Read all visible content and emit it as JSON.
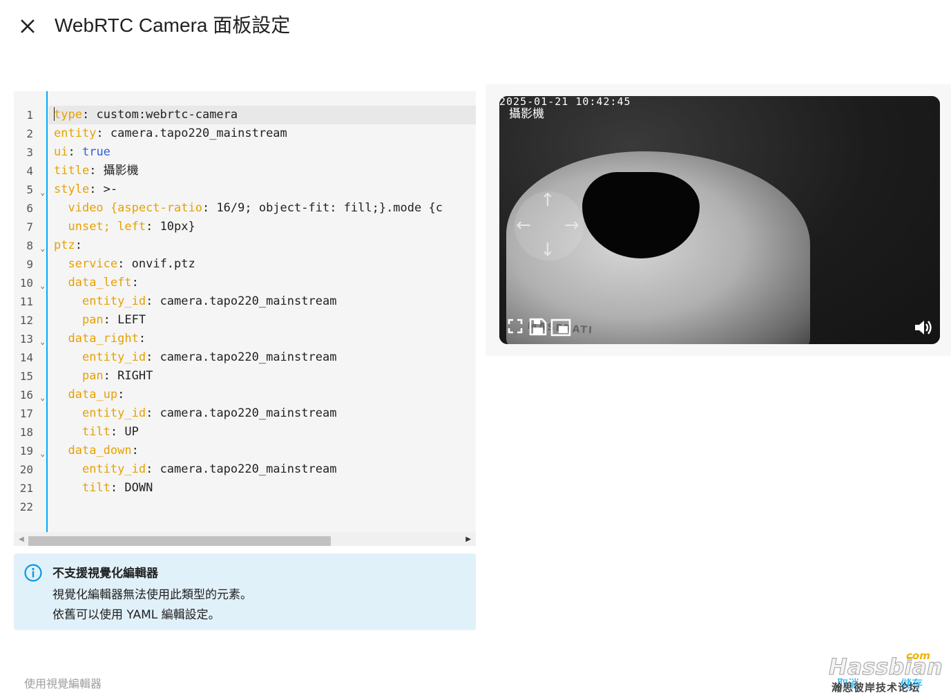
{
  "dialog": {
    "title": "WebRTC Camera 面板設定"
  },
  "editor": {
    "line_numbers": [
      "1",
      "2",
      "3",
      "4",
      "5",
      "6",
      "7",
      "8",
      "9",
      "10",
      "11",
      "12",
      "13",
      "14",
      "15",
      "16",
      "17",
      "18",
      "19",
      "20",
      "21",
      "22"
    ],
    "fold_lines": [
      5,
      8,
      10,
      13,
      16,
      19
    ],
    "lines": [
      {
        "indent": "",
        "key": "type",
        "sep": ": ",
        "value": "custom:webrtc-camera"
      },
      {
        "indent": "",
        "key": "entity",
        "sep": ": ",
        "value": "camera.tapo220_mainstream"
      },
      {
        "indent": "",
        "key": "ui",
        "sep": ": ",
        "value_bool": "true"
      },
      {
        "indent": "",
        "key": "title",
        "sep": ": ",
        "value": "攝影機"
      },
      {
        "indent": "",
        "key": "style",
        "sep": ": ",
        "value": ">-"
      },
      {
        "indent": "  ",
        "key": "video {aspect-ratio",
        "sep": ": ",
        "value": "16/9; object-fit: fill;}.mode {c"
      },
      {
        "indent": "  ",
        "key": "unset; left",
        "sep": ": ",
        "value": "10px}"
      },
      {
        "indent": "",
        "key": "ptz",
        "sep": ":",
        "value": ""
      },
      {
        "indent": "  ",
        "key": "service",
        "sep": ": ",
        "value": "onvif.ptz"
      },
      {
        "indent": "  ",
        "key": "data_left",
        "sep": ":",
        "value": ""
      },
      {
        "indent": "    ",
        "key": "entity_id",
        "sep": ": ",
        "value": "camera.tapo220_mainstream"
      },
      {
        "indent": "    ",
        "key": "pan",
        "sep": ": ",
        "value": "LEFT"
      },
      {
        "indent": "  ",
        "key": "data_right",
        "sep": ":",
        "value": ""
      },
      {
        "indent": "    ",
        "key": "entity_id",
        "sep": ": ",
        "value": "camera.tapo220_mainstream"
      },
      {
        "indent": "    ",
        "key": "pan",
        "sep": ": ",
        "value": "RIGHT"
      },
      {
        "indent": "  ",
        "key": "data_up",
        "sep": ":",
        "value": ""
      },
      {
        "indent": "    ",
        "key": "entity_id",
        "sep": ": ",
        "value": "camera.tapo220_mainstream"
      },
      {
        "indent": "    ",
        "key": "tilt",
        "sep": ": ",
        "value": "UP"
      },
      {
        "indent": "  ",
        "key": "data_down",
        "sep": ":",
        "value": ""
      },
      {
        "indent": "    ",
        "key": "entity_id",
        "sep": ": ",
        "value": "camera.tapo220_mainstream"
      },
      {
        "indent": "    ",
        "key": "tilt",
        "sep": ": ",
        "value": "DOWN"
      },
      {
        "indent": "",
        "key": "",
        "sep": "",
        "value": ""
      }
    ],
    "colors": {
      "key": "#e6a100",
      "bool": "#2d5fd7",
      "edge": "#03a9f4"
    }
  },
  "alert": {
    "title": "不支援視覺化編輯器",
    "line1": "視覺化編輯器無法使用此類型的元素。",
    "line2": "依舊可以使用 YAML 編輯設定。"
  },
  "camera": {
    "timestamp": "2025-01-21  10:42:45",
    "title": "攝影機",
    "shirt_text": "MASERATI"
  },
  "footer": {
    "visual_editor_label": "使用視覺編輯器",
    "cancel_label": "取消",
    "save_label": "儲存"
  },
  "watermark": {
    "com": "com",
    "brand": "Hassbian",
    "sub": "瀚思彼岸技术论坛"
  }
}
